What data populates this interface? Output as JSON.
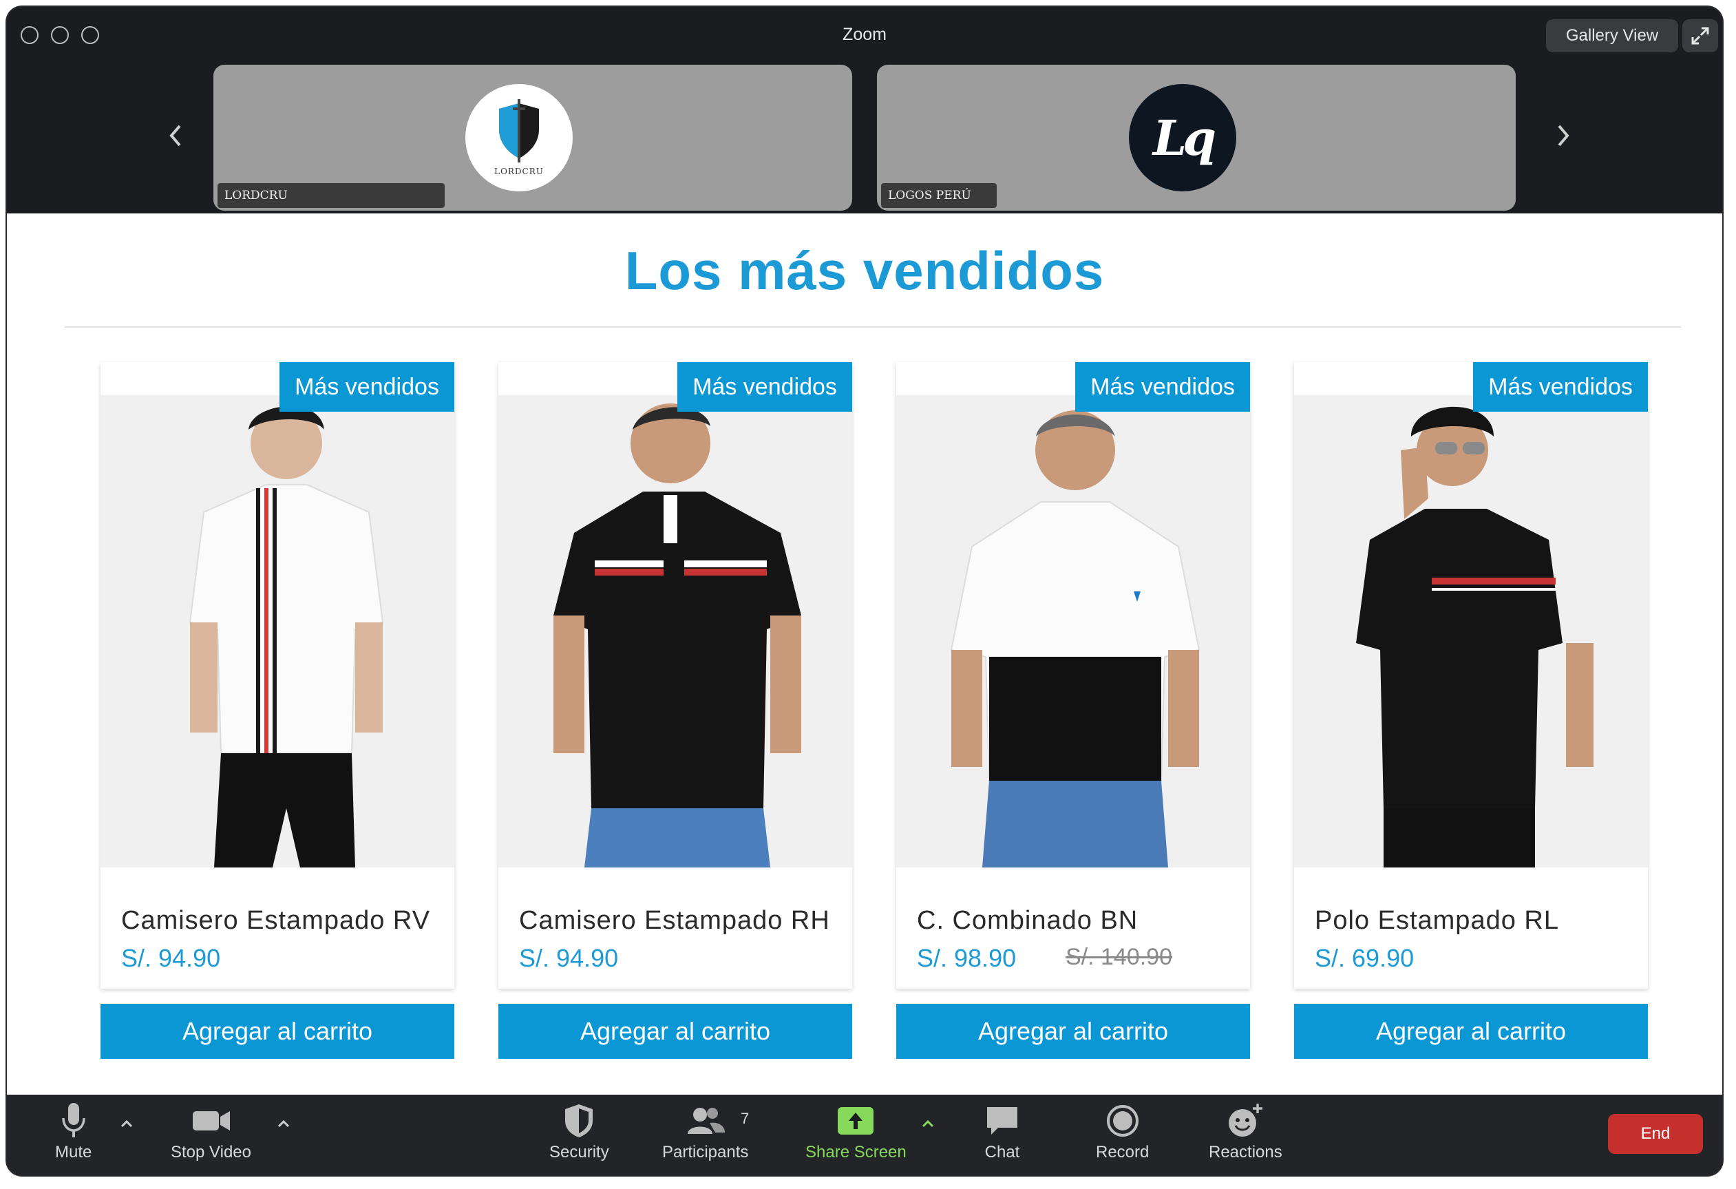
{
  "window": {
    "title": "Zoom",
    "gallery_view_label": "Gallery View"
  },
  "participants": [
    {
      "name": "LORDCRU",
      "avatar_caption": "LORDCRU"
    },
    {
      "name": "LOGOS PERÚ",
      "avatar_text": "Lq"
    }
  ],
  "shared_screen": {
    "heading": "Los más vendidos",
    "products": [
      {
        "badge": "Más vendidos",
        "name": "Camisero Estampado RV",
        "price": "S/. 94.90",
        "old_price": "",
        "button": "Agregar al carrito"
      },
      {
        "badge": "Más vendidos",
        "name": "Camisero Estampado RH",
        "price": "S/. 94.90",
        "old_price": "",
        "button": "Agregar al carrito"
      },
      {
        "badge": "Más vendidos",
        "name": "C. Combinado BN",
        "price": "S/. 98.90",
        "old_price": "S/. 140.90",
        "button": "Agregar al carrito"
      },
      {
        "badge": "Más vendidos",
        "name": "Polo Estampado RL",
        "price": "S/. 69.90",
        "old_price": "",
        "button": "Agregar al carrito"
      }
    ]
  },
  "toolbar": {
    "mute": "Mute",
    "stop_video": "Stop Video",
    "security": "Security",
    "participants": "Participants",
    "participants_count": "7",
    "share_screen": "Share Screen",
    "chat": "Chat",
    "record": "Record",
    "reactions": "Reactions",
    "end": "End"
  },
  "colors": {
    "accent": "#0b96d4",
    "heading": "#1b9ad6",
    "share_green": "#86d95a",
    "end_red": "#c6302c"
  }
}
